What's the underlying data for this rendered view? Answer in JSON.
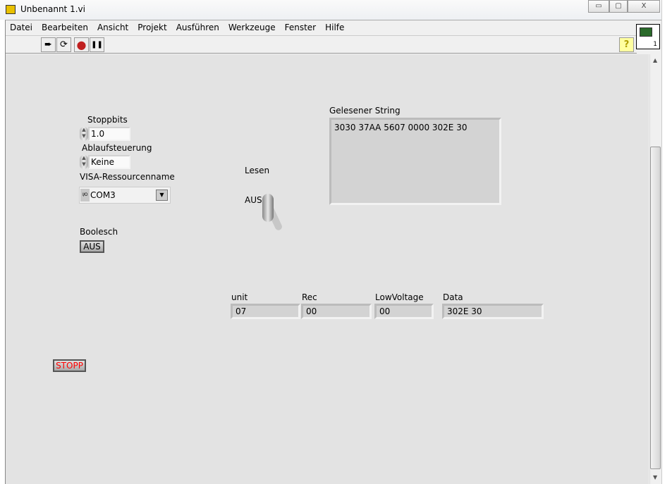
{
  "window": {
    "title": "Unbenannt 1.vi",
    "minimize": "▭",
    "restore": "▢",
    "close": "X"
  },
  "menu": [
    "Datei",
    "Bearbeiten",
    "Ansicht",
    "Projekt",
    "Ausführen",
    "Werkzeuge",
    "Fenster",
    "Hilfe"
  ],
  "toolbar": {
    "run": "➨",
    "run_continuous": "⟳",
    "abort": "●",
    "pause": "❚❚",
    "help": "?"
  },
  "vi_icon": {
    "number": "1"
  },
  "controls": {
    "stoppbits": {
      "label": "Stoppbits",
      "value": "1.0"
    },
    "ablaufsteuerung": {
      "label": "Ablaufsteuerung",
      "value": "Keine"
    },
    "visa": {
      "label": "VISA-Ressourcenname",
      "value": "COM3",
      "prefix": "I/O"
    },
    "boolesch": {
      "label": "Boolesch",
      "value": "AUS"
    },
    "lesen": {
      "label": "Lesen",
      "state": "AUS"
    },
    "stopp": {
      "label": "STOPP"
    }
  },
  "indicators": {
    "gelesener_string": {
      "label": "Gelesener String",
      "value": "3030 37AA 5607 0000 302E 30"
    },
    "unit": {
      "label": "unit",
      "value": "07"
    },
    "rec": {
      "label": "Rec",
      "value": "00"
    },
    "lowvoltage": {
      "label": "LowVoltage",
      "value": "00"
    },
    "data": {
      "label": "Data",
      "value": "302E 30"
    }
  },
  "colors": {
    "panel": "#e3e3e3",
    "stop_text": "#ff0000",
    "abort": "#c02020"
  }
}
